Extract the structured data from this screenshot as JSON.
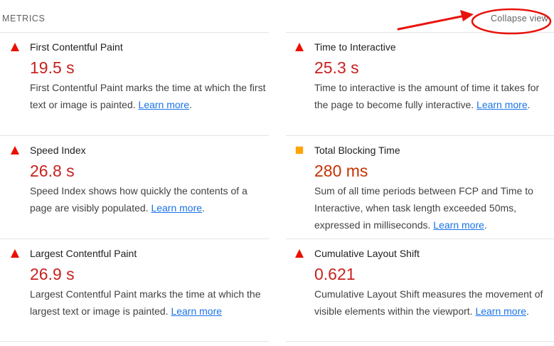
{
  "header": {
    "section_title": "METRICS",
    "collapse_label": "Collapse view"
  },
  "colors": {
    "fail": "#c7221f",
    "average": "#c33300",
    "fail_icon": "#eb0f00",
    "average_icon": "#ffa400",
    "link": "#1a73e8",
    "annotation": "#e8130c"
  },
  "metrics": [
    {
      "title": "First Contentful Paint",
      "value": "19.5 s",
      "status": "fail",
      "icon": "red-triangle-icon",
      "desc": "First Contentful Paint marks the time at which the first text or image is painted. ",
      "link": "Learn more",
      "tail": "."
    },
    {
      "title": "Time to Interactive",
      "value": "25.3 s",
      "status": "fail",
      "icon": "red-triangle-icon",
      "desc": "Time to interactive is the amount of time it takes for the page to become fully interactive. ",
      "link": "Learn more",
      "tail": "."
    },
    {
      "title": "Speed Index",
      "value": "26.8 s",
      "status": "fail",
      "icon": "red-triangle-icon",
      "desc": "Speed Index shows how quickly the contents of a page are visibly populated. ",
      "link": "Learn more",
      "tail": "."
    },
    {
      "title": "Total Blocking Time",
      "value": "280 ms",
      "status": "average",
      "icon": "orange-square-icon",
      "desc": "Sum of all time periods between FCP and Time to Interactive, when task length exceeded 50ms, expressed in milliseconds. ",
      "link": "Learn more",
      "tail": "."
    },
    {
      "title": "Largest Contentful Paint",
      "value": "26.9 s",
      "status": "fail",
      "icon": "red-triangle-icon",
      "desc": "Largest Contentful Paint marks the time at which the largest text or image is painted. ",
      "link": "Learn more",
      "tail": ""
    },
    {
      "title": "Cumulative Layout Shift",
      "value": "0.621",
      "status": "fail",
      "icon": "red-triangle-icon",
      "desc": "Cumulative Layout Shift measures the movement of visible elements within the viewport. ",
      "link": "Learn more",
      "tail": "."
    }
  ]
}
